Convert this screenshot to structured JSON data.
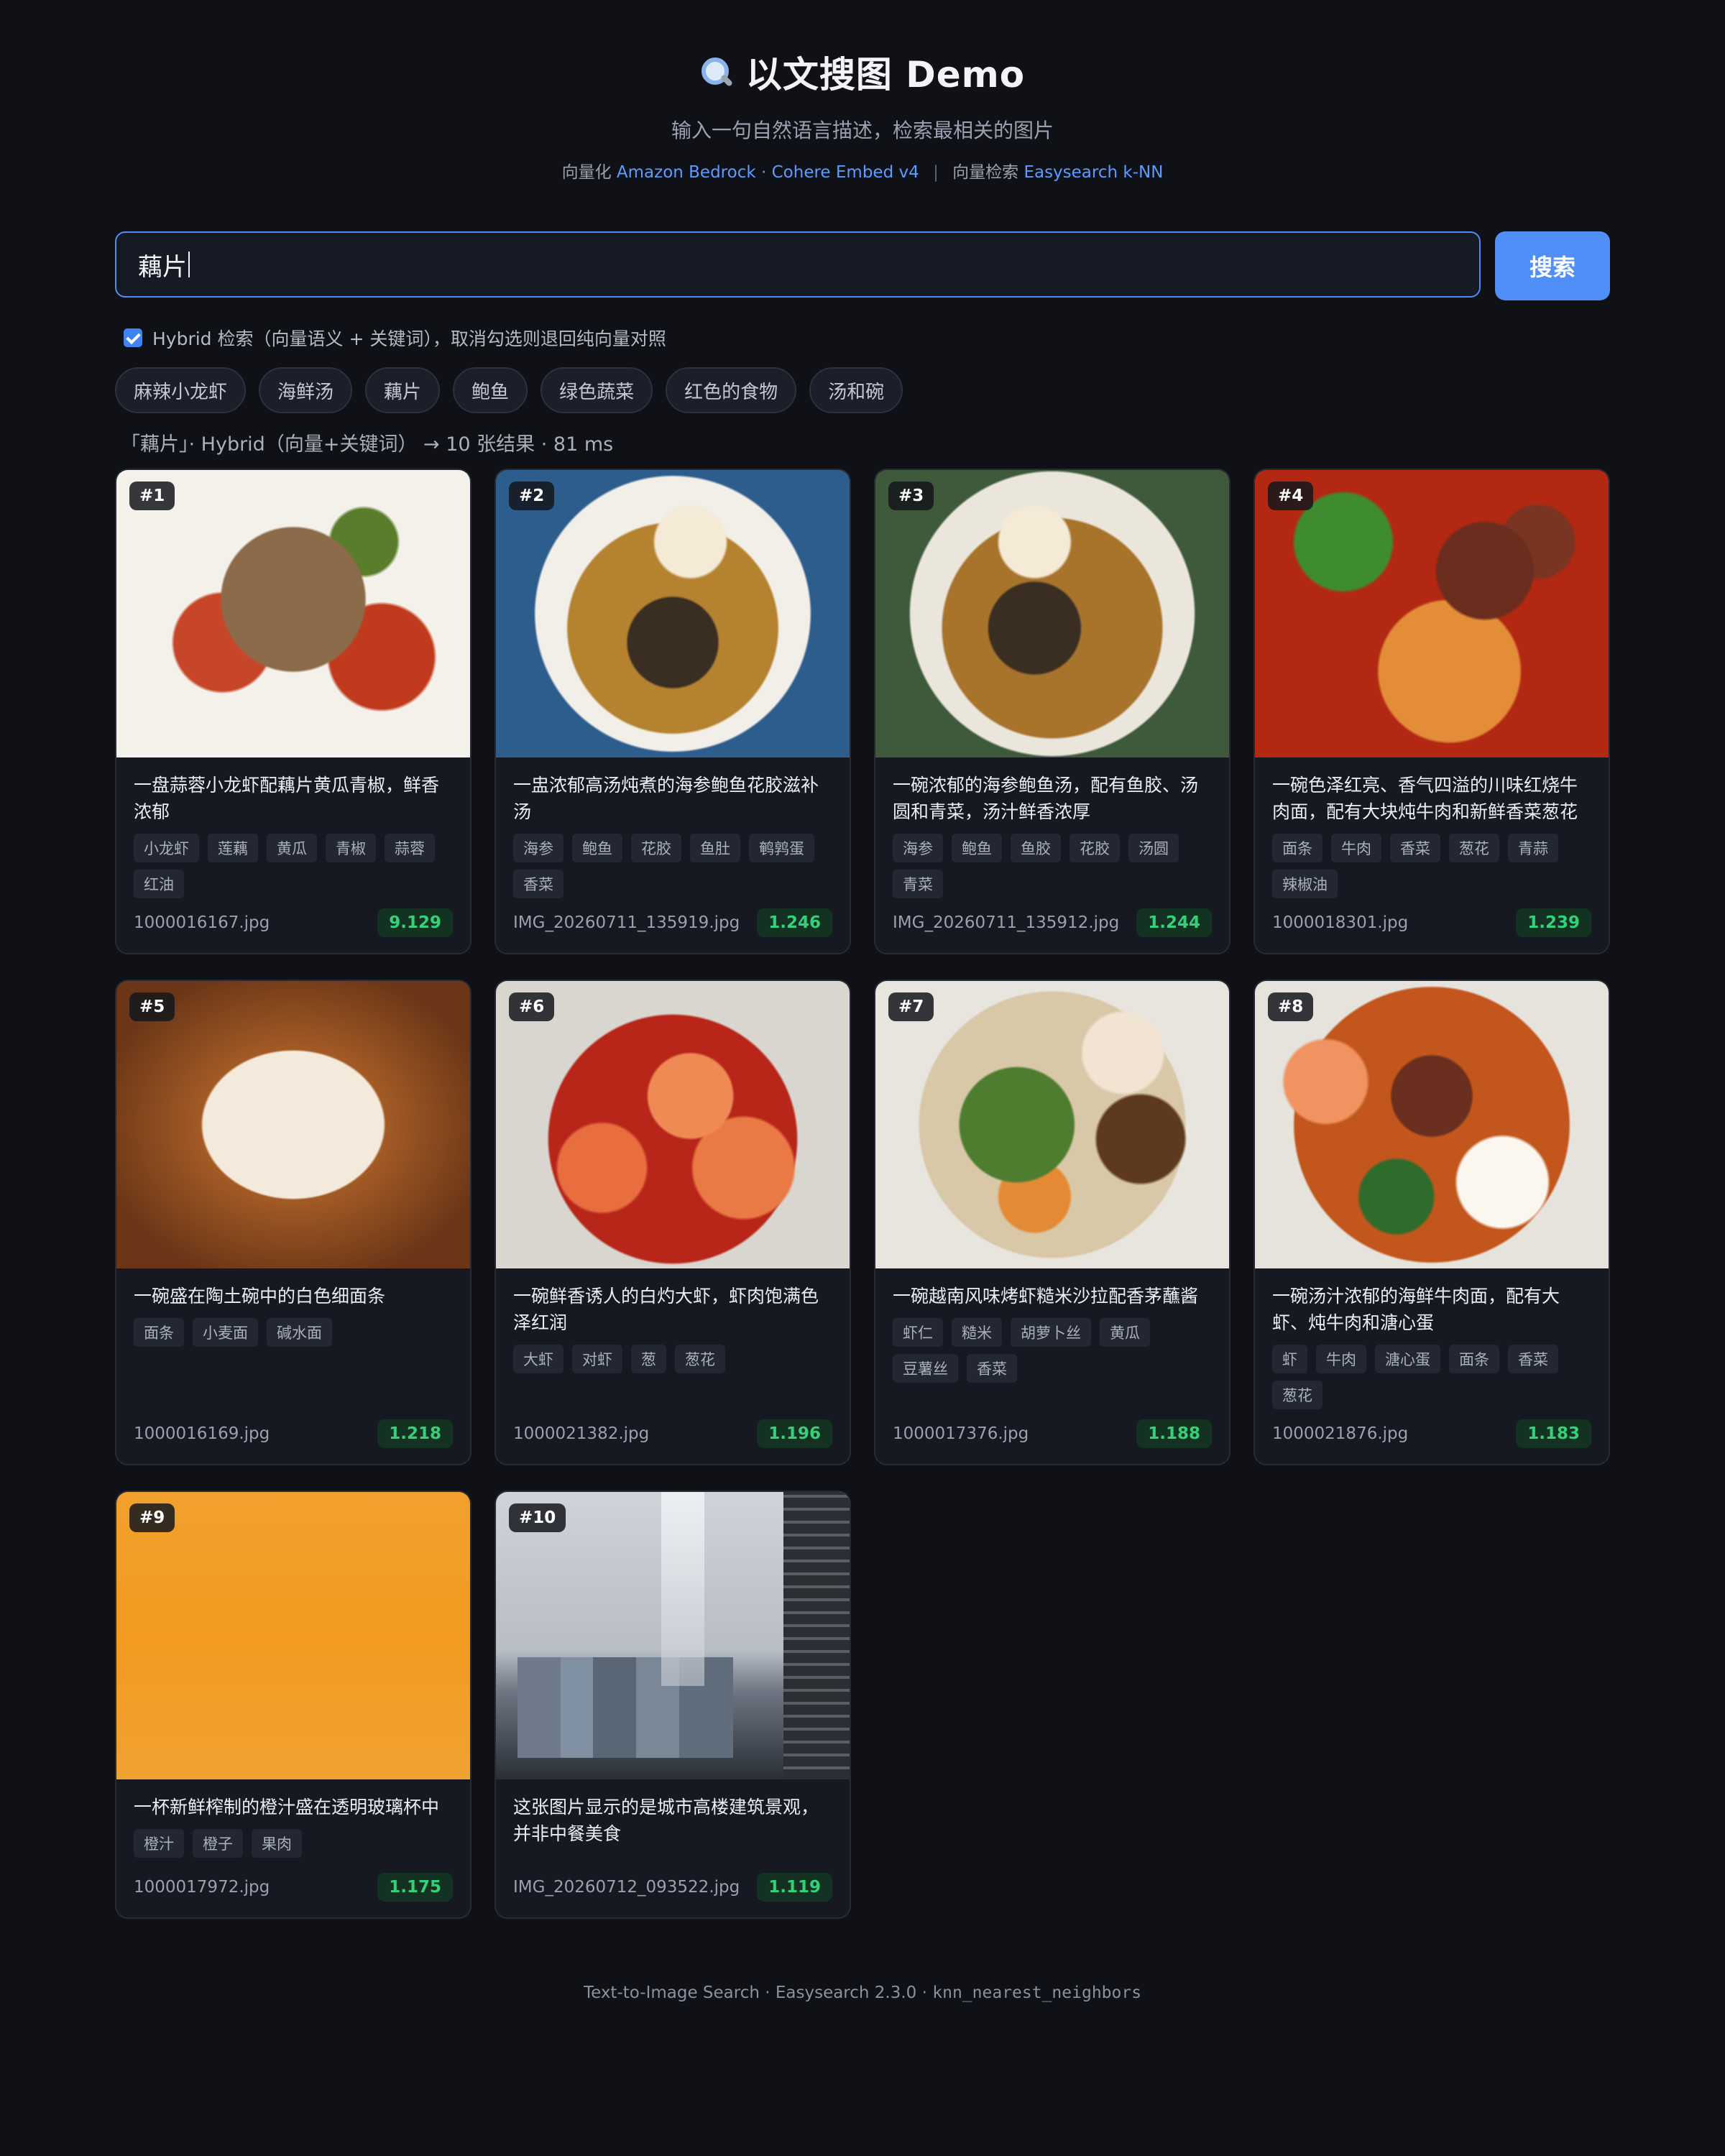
{
  "header": {
    "title": "以文搜图 Demo",
    "subtitle": "输入一句自然语言描述，检索最相关的图片",
    "credits": {
      "embed_prefix": "向量化",
      "embed_provider": "Amazon Bedrock",
      "dot": "·",
      "embed_model": "Cohere Embed v4",
      "sep": "|",
      "search_prefix": "向量检索",
      "search_engine": "Easysearch k-NN"
    }
  },
  "search": {
    "query": "藕片",
    "button_label": "搜索"
  },
  "hybrid": {
    "checked": true,
    "label": "Hybrid 检索（向量语义 + 关键词），取消勾选则退回纯向量对照"
  },
  "chips": [
    "麻辣小龙虾",
    "海鲜汤",
    "藕片",
    "鲍鱼",
    "绿色蔬菜",
    "红色的食物",
    "汤和碗"
  ],
  "status": "「藕片」· Hybrid（向量+关键词） → 10 张结果 · 81 ms",
  "results": [
    {
      "rank": "#1",
      "caption": "一盘蒜蓉小龙虾配藕片黄瓜青椒，鲜香浓郁",
      "tags": [
        "小龙虾",
        "莲藕",
        "黄瓜",
        "青椒",
        "蒜蓉",
        "红油"
      ],
      "file": "1000016167.jpg",
      "score": "9.129"
    },
    {
      "rank": "#2",
      "caption": "一盅浓郁高汤炖煮的海参鲍鱼花胶滋补汤",
      "tags": [
        "海参",
        "鲍鱼",
        "花胶",
        "鱼肚",
        "鹌鹑蛋",
        "香菜"
      ],
      "file": "IMG_20260711_135919.jpg",
      "score": "1.246"
    },
    {
      "rank": "#3",
      "caption": "一碗浓郁的海参鲍鱼汤，配有鱼胶、汤圆和青菜，汤汁鲜香浓厚",
      "tags": [
        "海参",
        "鲍鱼",
        "鱼胶",
        "花胶",
        "汤圆",
        "青菜"
      ],
      "file": "IMG_20260711_135912.jpg",
      "score": "1.244"
    },
    {
      "rank": "#4",
      "caption": "一碗色泽红亮、香气四溢的川味红烧牛肉面，配有大块炖牛肉和新鲜香菜葱花",
      "tags": [
        "面条",
        "牛肉",
        "香菜",
        "葱花",
        "青蒜",
        "辣椒油"
      ],
      "file": "1000018301.jpg",
      "score": "1.239"
    },
    {
      "rank": "#5",
      "caption": "一碗盛在陶土碗中的白色细面条",
      "tags": [
        "面条",
        "小麦面",
        "碱水面"
      ],
      "file": "1000016169.jpg",
      "score": "1.218"
    },
    {
      "rank": "#6",
      "caption": "一碗鲜香诱人的白灼大虾，虾肉饱满色泽红润",
      "tags": [
        "大虾",
        "对虾",
        "葱",
        "葱花"
      ],
      "file": "1000021382.jpg",
      "score": "1.196"
    },
    {
      "rank": "#7",
      "caption": "一碗越南风味烤虾糙米沙拉配香茅蘸酱",
      "tags": [
        "虾仁",
        "糙米",
        "胡萝卜丝",
        "黄瓜",
        "豆薯丝",
        "香菜"
      ],
      "file": "1000017376.jpg",
      "score": "1.188"
    },
    {
      "rank": "#8",
      "caption": "一碗汤汁浓郁的海鲜牛肉面，配有大虾、炖牛肉和溏心蛋",
      "tags": [
        "虾",
        "牛肉",
        "溏心蛋",
        "面条",
        "香菜",
        "葱花"
      ],
      "file": "1000021876.jpg",
      "score": "1.183"
    },
    {
      "rank": "#9",
      "caption": "一杯新鲜榨制的橙汁盛在透明玻璃杯中",
      "tags": [
        "橙汁",
        "橙子",
        "果肉"
      ],
      "file": "1000017972.jpg",
      "score": "1.175"
    },
    {
      "rank": "#10",
      "caption": "这张图片显示的是城市高楼建筑景观，并非中餐美食",
      "tags": [],
      "file": "IMG_20260712_093522.jpg",
      "score": "1.119"
    }
  ],
  "footer": {
    "text": "Text-to-Image Search · Easysearch 2.3.0 · ",
    "mono": "knn_nearest_neighbors"
  },
  "colors": {
    "background": "#0f1117",
    "accent": "#4f8ff7",
    "link": "#5c9cff",
    "score_green": "#34d17a"
  }
}
